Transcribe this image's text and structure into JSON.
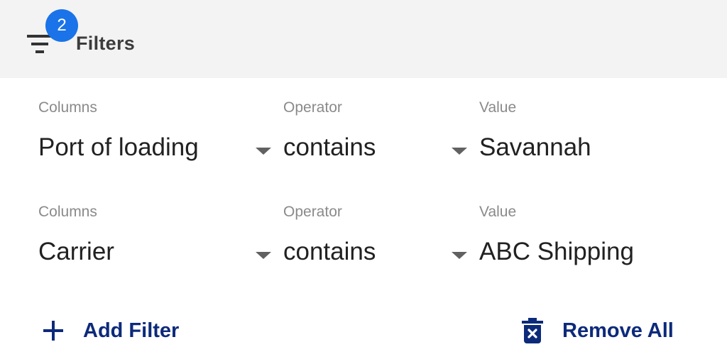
{
  "header": {
    "title": "Filters",
    "badge_count": "2",
    "filter_icon": "filter-list-icon",
    "badge_color": "#1a73e8",
    "background": "#f3f3f3"
  },
  "filters": [
    {
      "columns_label": "Columns",
      "column_value": "Port of loading",
      "operator_label": "Operator",
      "operator_value": "contains",
      "value_label": "Value",
      "value": "Savannah"
    },
    {
      "columns_label": "Columns",
      "column_value": "Carrier",
      "operator_label": "Operator",
      "operator_value": "contains",
      "value_label": "Value",
      "value": "ABC Shipping"
    }
  ],
  "actions": {
    "add_filter_label": "Add Filter",
    "add_filter_icon": "plus-icon",
    "remove_all_label": "Remove All",
    "remove_all_icon": "delete-forever-icon",
    "accent_color": "#0d2a7a"
  }
}
